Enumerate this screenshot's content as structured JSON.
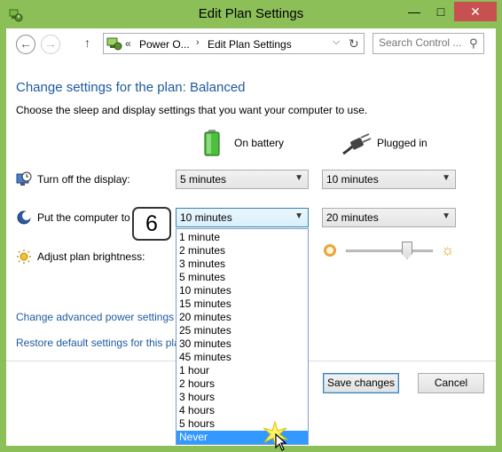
{
  "window": {
    "title": "Edit Plan Settings",
    "minimize_glyph": "—",
    "maximize_glyph": "□",
    "close_glyph": "✕"
  },
  "toolbar": {
    "back_glyph": "←",
    "forward_glyph": "→",
    "up_glyph": "↑",
    "address_prefix": "«",
    "breadcrumb": [
      "Power O...",
      "Edit Plan Settings"
    ],
    "breadcrumb_separator": "›",
    "address_dropdown_glyph": "⌵",
    "refresh_glyph": "↻",
    "search_placeholder": "Search Control ...",
    "search_glyph": "⚲"
  },
  "main": {
    "heading": "Change settings for the plan: Balanced",
    "description": "Choose the sleep and display settings that you want your computer to use.",
    "columns": {
      "battery": "On battery",
      "plugged": "Plugged in"
    },
    "rows": {
      "display": {
        "label": "Turn off the display:",
        "battery_value": "5 minutes",
        "plugged_value": "10 minutes"
      },
      "sleep": {
        "label": "Put the computer to",
        "battery_value": "10 minutes",
        "plugged_value": "20 minutes"
      },
      "brightness": {
        "label": "Adjust plan brightness:",
        "brightness_level": 0.75
      }
    },
    "dropdown_arrow": "▼",
    "links": {
      "advanced": "Change advanced power settings",
      "restore": "Restore default settings for this pla"
    },
    "buttons": {
      "save": "Save changes",
      "cancel": "Cancel"
    }
  },
  "dropdown": {
    "options": [
      "1 minute",
      "2 minutes",
      "3 minutes",
      "5 minutes",
      "10 minutes",
      "15 minutes",
      "20 minutes",
      "25 minutes",
      "30 minutes",
      "45 minutes",
      "1 hour",
      "2 hours",
      "3 hours",
      "4 hours",
      "5 hours",
      "Never"
    ],
    "highlighted": "Never"
  },
  "annotation": {
    "step_number": "6"
  },
  "colors": {
    "window_frame": "#8cbf58",
    "heading_text": "#1e5aa0",
    "highlight": "#3399ff",
    "close_button": "#c75050"
  }
}
